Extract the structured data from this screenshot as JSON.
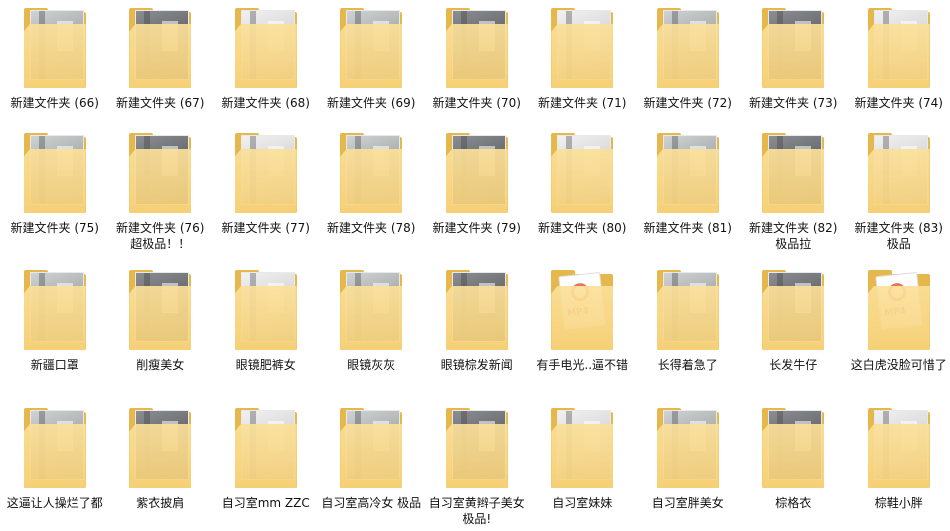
{
  "folders": [
    {
      "label": "新建文件夹 (66)",
      "kind": "photo"
    },
    {
      "label": "新建文件夹 (67)",
      "kind": "photo"
    },
    {
      "label": "新建文件夹 (68)",
      "kind": "photo"
    },
    {
      "label": "新建文件夹 (69)",
      "kind": "photo"
    },
    {
      "label": "新建文件夹 (70)",
      "kind": "photo"
    },
    {
      "label": "新建文件夹 (71)",
      "kind": "photo"
    },
    {
      "label": "新建文件夹 (72)",
      "kind": "photo"
    },
    {
      "label": "新建文件夹 (73)",
      "kind": "photo"
    },
    {
      "label": "新建文件夹 (74)",
      "kind": "photo"
    },
    {
      "label": "新建文件夹 (75)",
      "kind": "photo"
    },
    {
      "label": "新建文件夹 (76) 超极品！！",
      "kind": "photo"
    },
    {
      "label": "新建文件夹 (77)",
      "kind": "photo"
    },
    {
      "label": "新建文件夹 (78)",
      "kind": "photo"
    },
    {
      "label": "新建文件夹 (79)",
      "kind": "photo"
    },
    {
      "label": "新建文件夹 (80)",
      "kind": "photo"
    },
    {
      "label": "新建文件夹 (81)",
      "kind": "photo"
    },
    {
      "label": "新建文件夹 (82) 极品拉",
      "kind": "photo"
    },
    {
      "label": "新建文件夹 (83) 极品",
      "kind": "photo"
    },
    {
      "label": "新疆口罩",
      "kind": "photo"
    },
    {
      "label": "削瘦美女",
      "kind": "photo"
    },
    {
      "label": "眼镜肥裤女",
      "kind": "photo"
    },
    {
      "label": "眼镜灰灰",
      "kind": "photo"
    },
    {
      "label": "眼镜棕发新闻",
      "kind": "photo"
    },
    {
      "label": "有手电光..逼不错",
      "kind": "mp4"
    },
    {
      "label": "长得着急了",
      "kind": "photo"
    },
    {
      "label": "长发牛仔",
      "kind": "photo"
    },
    {
      "label": "这白虎没脸可惜了",
      "kind": "mp4"
    },
    {
      "label": "这逼让人操烂了都",
      "kind": "photo"
    },
    {
      "label": "紫衣披肩",
      "kind": "photo"
    },
    {
      "label": "自习室mm ZZC",
      "kind": "photo"
    },
    {
      "label": "自习室高冷女 极品",
      "kind": "photo"
    },
    {
      "label": "自习室黄辫子美女 极品!",
      "kind": "photo"
    },
    {
      "label": "自习室妹妹",
      "kind": "photo"
    },
    {
      "label": "自习室胖美女",
      "kind": "photo"
    },
    {
      "label": "棕格衣",
      "kind": "photo"
    },
    {
      "label": "棕鞋小胖",
      "kind": "photo"
    }
  ],
  "mp4_tag": "MP4"
}
